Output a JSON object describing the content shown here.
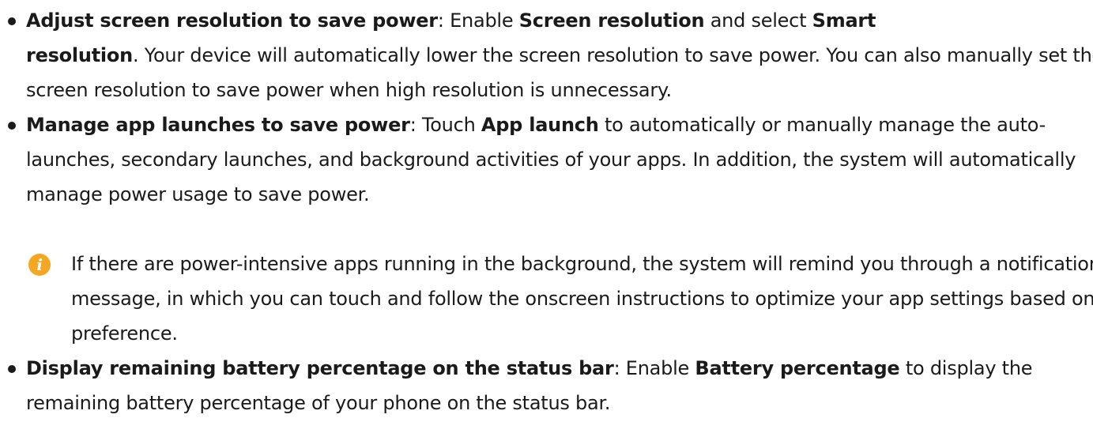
{
  "items": [
    {
      "title": "Adjust screen resolution to save power",
      "seg1": ": Enable ",
      "bold1": "Screen resolution",
      "seg2": " and select ",
      "bold2": "Smart",
      "bold2b": "resolution",
      "seg3": ". Your device will automatically lower the screen resolution to save power. You can also manually set the screen resolution to save power when high resolution is unnecessary."
    },
    {
      "title": "Manage app launches to save power",
      "seg1": ": Touch ",
      "bold1": "App launch",
      "seg2": " to automatically or manually manage the auto-launches, secondary launches, and background activities of your apps. In addition, the system will automatically manage power usage to save power."
    },
    {
      "title": "Display remaining battery percentage on the status bar",
      "seg1": ": Enable ",
      "bold1": "Battery percentage",
      "seg2": " to display the remaining battery percentage of your phone on the status bar."
    }
  ],
  "note": {
    "icon": "info-icon",
    "text": "If there are power-intensive apps running in the background, the system will remind you through a notification message, in which you can touch and follow the onscreen instructions to optimize your app settings based on your preference."
  },
  "colors": {
    "text": "#1a1a1a",
    "note_icon": "#f5a623"
  }
}
